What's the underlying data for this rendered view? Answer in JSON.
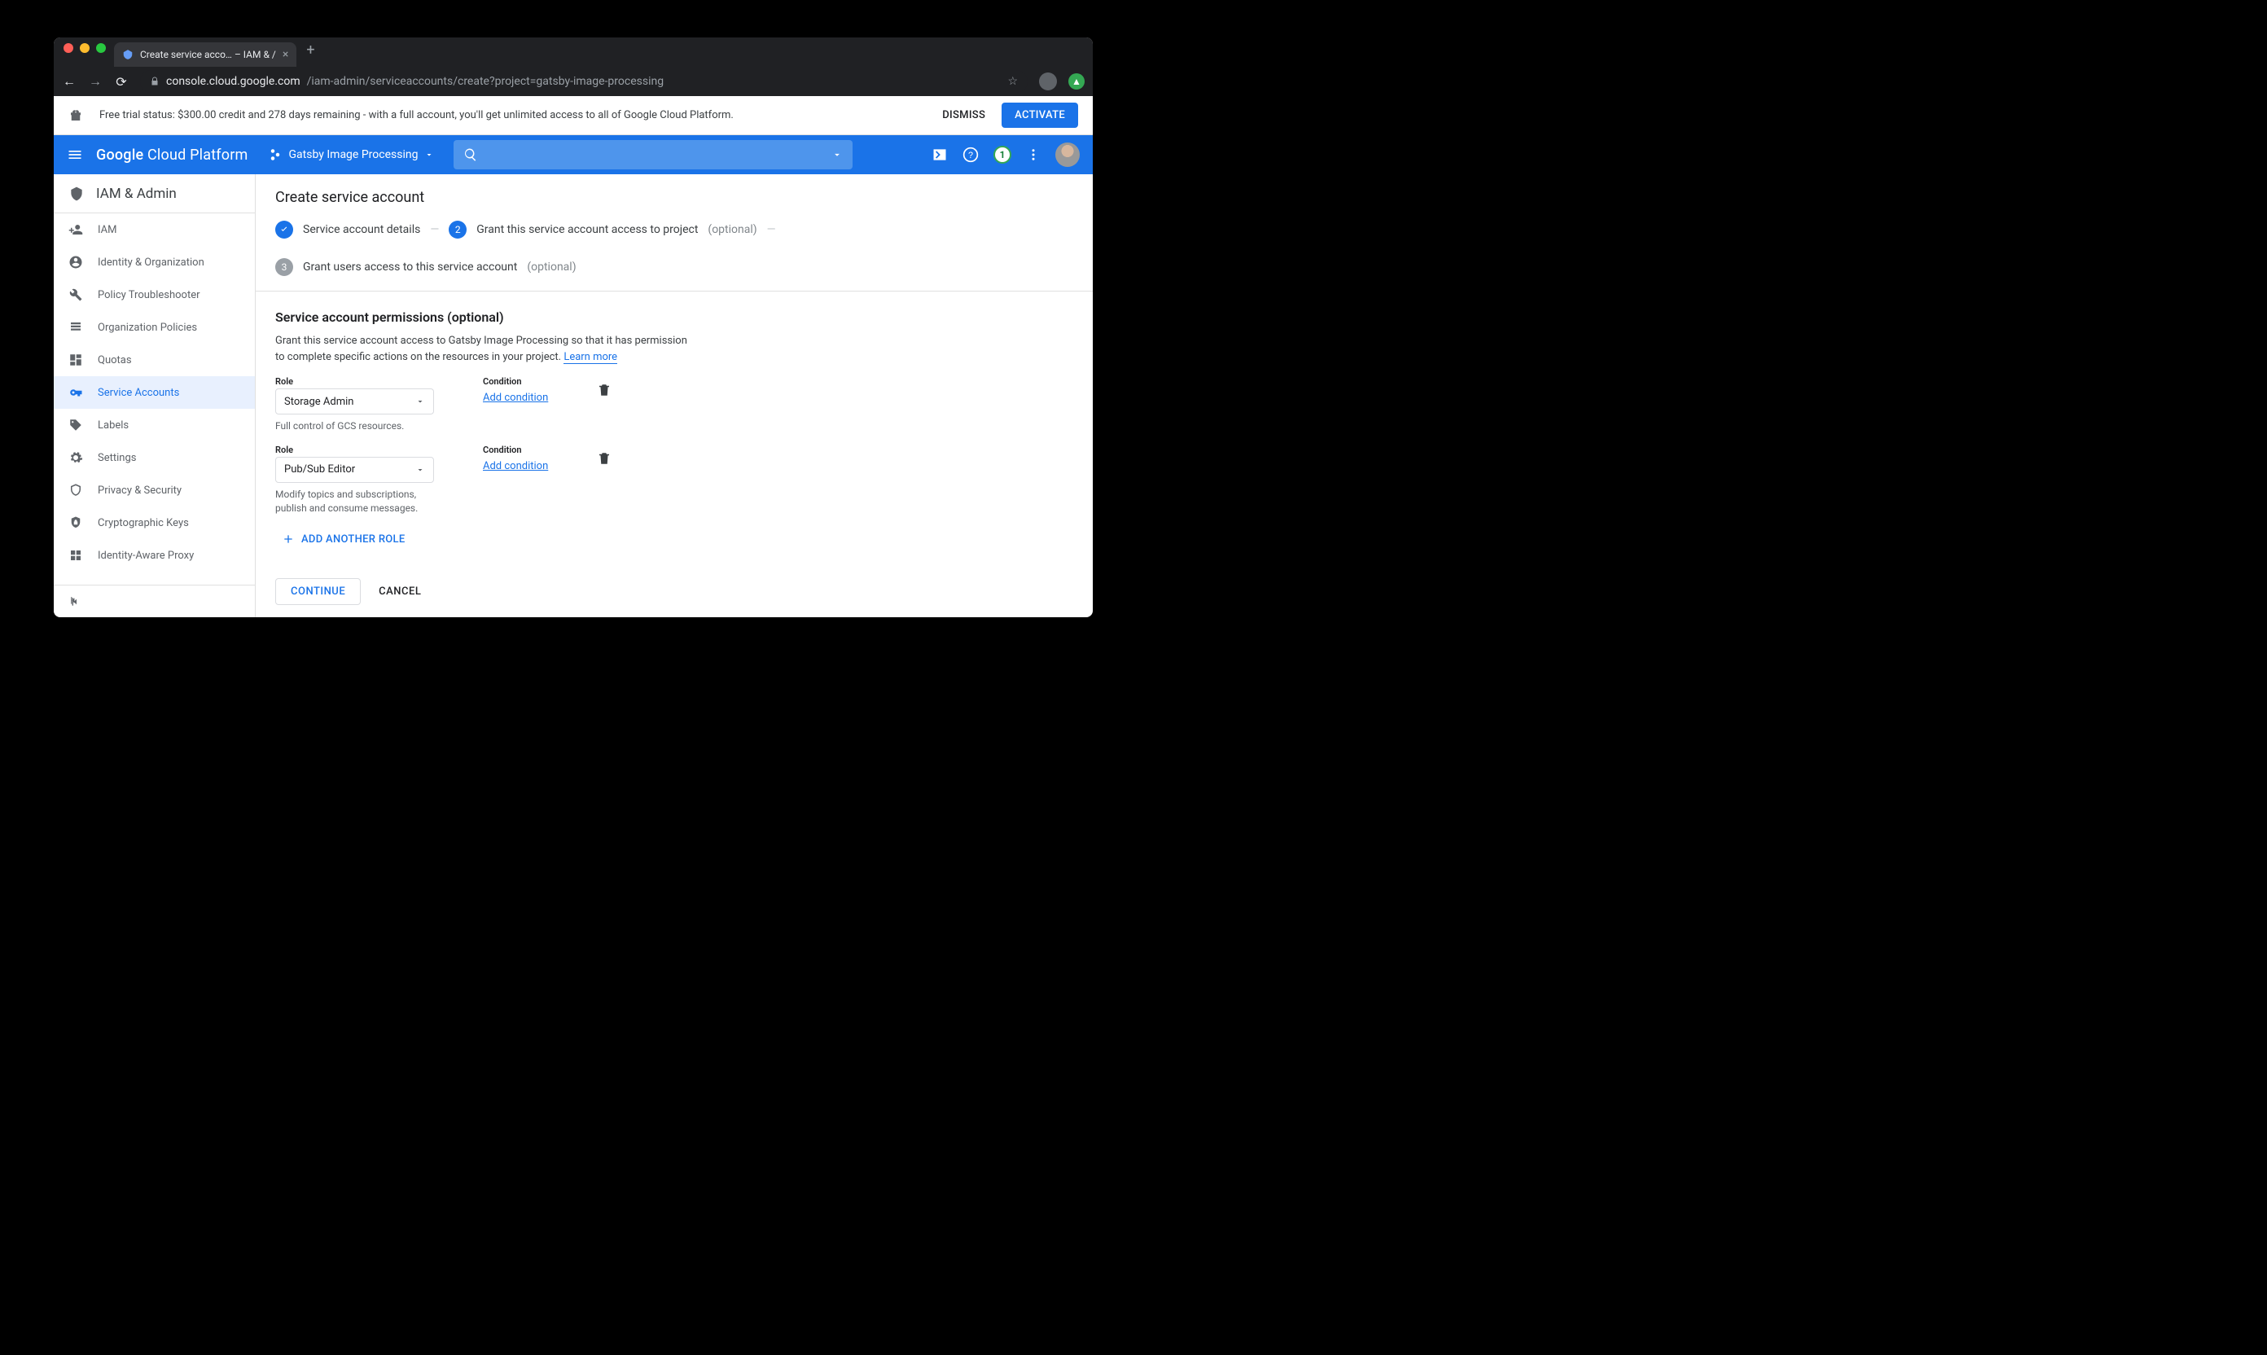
{
  "browser": {
    "tab_title": "Create service acco… – IAM & /",
    "url_host": "console.cloud.google.com",
    "url_path": "/iam-admin/serviceaccounts/create?project=gatsby-image-processing"
  },
  "trial": {
    "text": "Free trial status: $300.00 credit and 278 days remaining - with a full account, you'll get unlimited access to all of Google Cloud Platform.",
    "dismiss": "DISMISS",
    "activate": "ACTIVATE"
  },
  "header": {
    "product": "Google Cloud Platform",
    "project": "Gatsby Image Processing",
    "notif_count": "1"
  },
  "sidebar": {
    "title": "IAM & Admin",
    "items": [
      {
        "label": "IAM"
      },
      {
        "label": "Identity & Organization"
      },
      {
        "label": "Policy Troubleshooter"
      },
      {
        "label": "Organization Policies"
      },
      {
        "label": "Quotas"
      },
      {
        "label": "Service Accounts"
      },
      {
        "label": "Labels"
      },
      {
        "label": "Settings"
      },
      {
        "label": "Privacy & Security"
      },
      {
        "label": "Cryptographic Keys"
      },
      {
        "label": "Identity-Aware Proxy"
      }
    ]
  },
  "main": {
    "title": "Create service account",
    "steps": {
      "s1": "Service account details",
      "s2": "Grant this service account access to project",
      "s2_opt": "(optional)",
      "s3": "Grant users access to this service account",
      "s3_opt": "(optional)",
      "n2": "2",
      "n3": "3"
    },
    "perm": {
      "heading": "Service account permissions (optional)",
      "desc": "Grant this service account access to Gatsby Image Processing so that it has permission to complete specific actions on the resources in your project. ",
      "learn": "Learn more"
    },
    "roles": [
      {
        "label": "Role",
        "value": "Storage Admin",
        "help": "Full control of GCS resources.",
        "cond_label": "Condition",
        "add_cond": "Add condition"
      },
      {
        "label": "Role",
        "value": "Pub/Sub Editor",
        "help": "Modify topics and subscriptions, publish and consume messages.",
        "cond_label": "Condition",
        "add_cond": "Add condition"
      }
    ],
    "add_role": "ADD ANOTHER ROLE",
    "continue": "CONTINUE",
    "cancel": "CANCEL"
  }
}
